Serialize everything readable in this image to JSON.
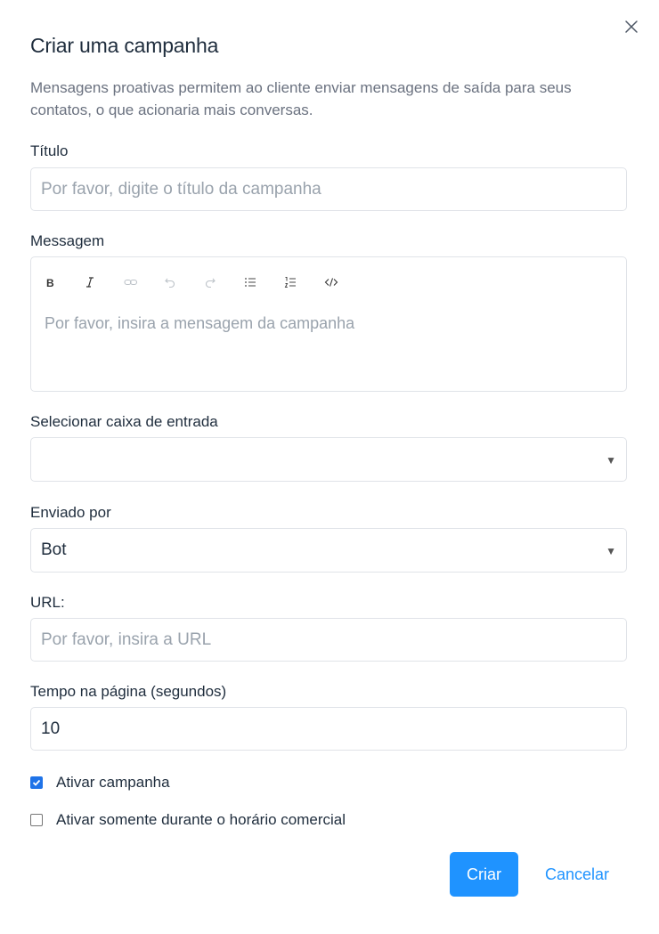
{
  "modal": {
    "title": "Criar uma campanha",
    "description": "Mensagens proativas permitem ao cliente enviar mensagens de saída para seus contatos, o que acionaria mais conversas."
  },
  "fields": {
    "title_label": "Título",
    "title_placeholder": "Por favor, digite o título da campanha",
    "message_label": "Messagem",
    "message_placeholder": "Por favor, insira a mensagem da campanha",
    "inbox_label": "Selecionar caixa de entrada",
    "inbox_value": "",
    "sender_label": "Enviado por",
    "sender_value": "Bot",
    "url_label": "URL:",
    "url_placeholder": "Por favor, insira a URL",
    "time_label": "Tempo na página (segundos)",
    "time_value": "10"
  },
  "toolbar": {
    "items": [
      "bold-icon",
      "italic-icon",
      "link-icon",
      "undo-icon",
      "redo-icon",
      "bullet-list-icon",
      "ordered-list-icon",
      "code-icon"
    ]
  },
  "options": {
    "enable_campaign": "Ativar campanha",
    "enable_campaign_checked": true,
    "business_hours": "Ativar somente durante o horário comercial",
    "business_hours_checked": false
  },
  "actions": {
    "create": "Criar",
    "cancel": "Cancelar"
  },
  "colors": {
    "primary": "#1f93ff",
    "checkbox_checked": "#1f73e8"
  }
}
